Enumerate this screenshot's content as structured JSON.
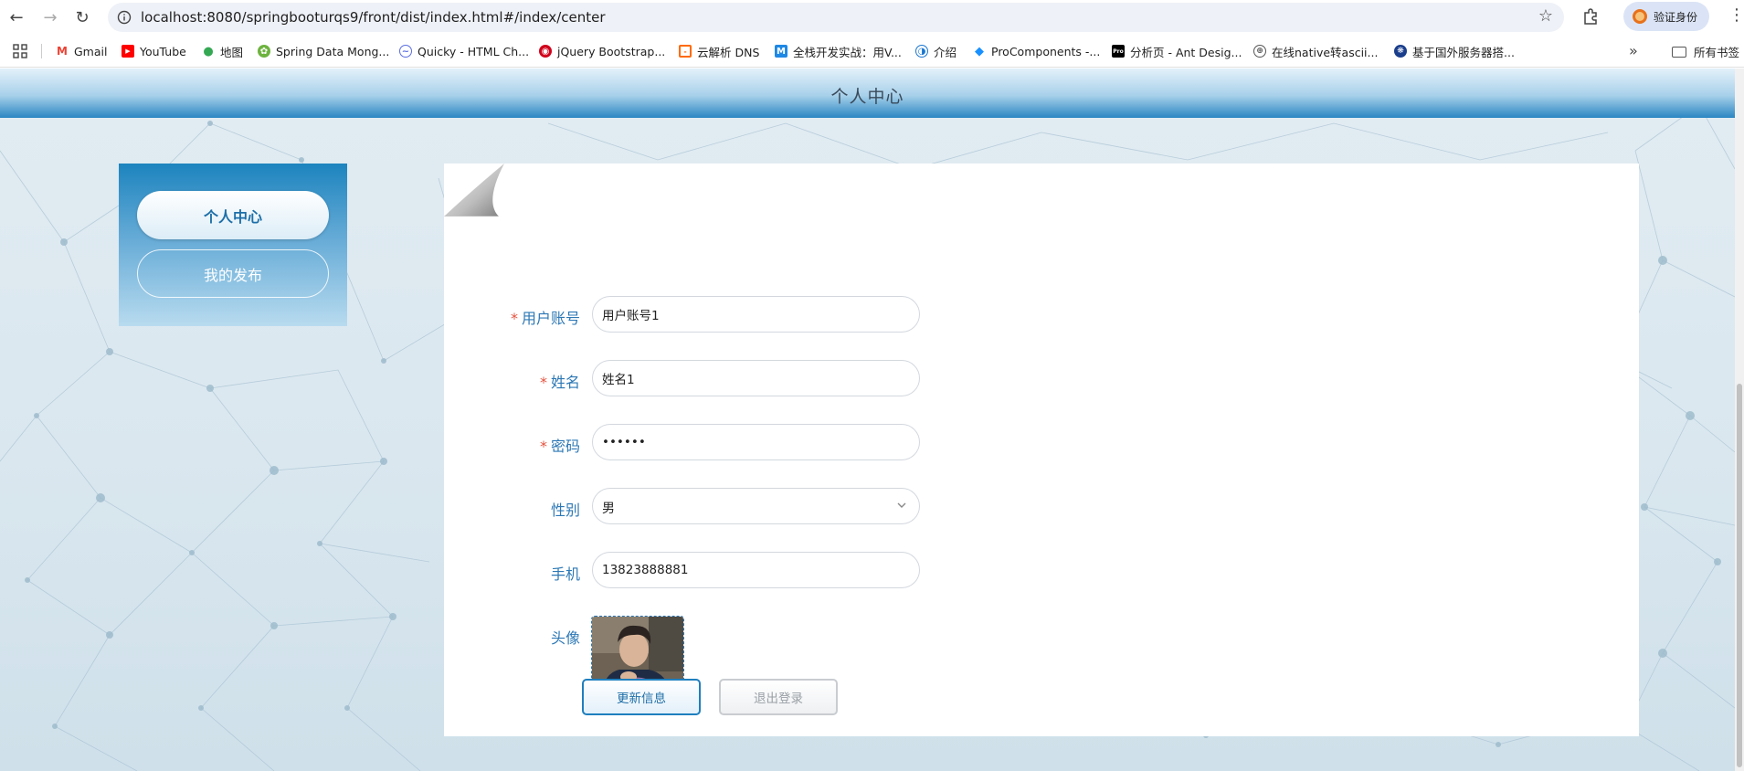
{
  "browser": {
    "url": "localhost:8080/springbooturqs9/front/dist/index.html#/index/center",
    "profile_label": "验证身份",
    "bookmarks": [
      {
        "label": "Gmail",
        "icon": "gmail-icon",
        "color": "#ea4335"
      },
      {
        "label": "YouTube",
        "icon": "youtube-icon",
        "color": "#ff0000"
      },
      {
        "label": "地图",
        "icon": "maps-icon",
        "color": "#34a853"
      },
      {
        "label": "Spring Data Mong...",
        "icon": "spring-icon",
        "color": "#6db33f"
      },
      {
        "label": "Quicky - HTML Ch...",
        "icon": "quicky-icon",
        "color": "#5b6ee1"
      },
      {
        "label": "jQuery Bootstrap...",
        "icon": "jquery-icon",
        "color": "#d0021b"
      },
      {
        "label": "云解析 DNS",
        "icon": "dns-icon",
        "color": "#ff6a00"
      },
      {
        "label": "全栈开发实战：用V...",
        "icon": "m-icon",
        "color": "#1e88e5"
      },
      {
        "label": "介绍",
        "icon": "intro-icon",
        "color": "#1976d2"
      },
      {
        "label": "ProComponents -...",
        "icon": "procomponents-icon",
        "color": "#1890ff"
      },
      {
        "label": "分析页 - Ant Desig...",
        "icon": "pro-icon",
        "color": "#000000"
      },
      {
        "label": "在线native转ascii...",
        "icon": "globe-icon",
        "color": "#555555"
      },
      {
        "label": "基于国外服务器搭...",
        "icon": "server-icon",
        "color": "#1a3e8c"
      }
    ],
    "bookmarks_folder": "所有书签"
  },
  "page": {
    "title": "个人中心"
  },
  "sidebar": {
    "items": [
      {
        "label": "个人中心",
        "active": true
      },
      {
        "label": "我的发布",
        "active": false
      }
    ]
  },
  "form": {
    "required_mark": "*",
    "account": {
      "label": "用户账号",
      "value": "用户账号1",
      "required": true
    },
    "name": {
      "label": "姓名",
      "value": "姓名1",
      "required": true
    },
    "password": {
      "label": "密码",
      "value": "••••••",
      "required": true
    },
    "gender": {
      "label": "性别",
      "value": "男",
      "required": false
    },
    "phone": {
      "label": "手机",
      "value": "13823888881",
      "required": false
    },
    "avatar": {
      "label": "头像"
    }
  },
  "buttons": {
    "update": "更新信息",
    "logout": "退出登录"
  },
  "colors": {
    "accent": "#2d78b5",
    "header_blue": "#2a86c2",
    "required": "#e5533e"
  }
}
